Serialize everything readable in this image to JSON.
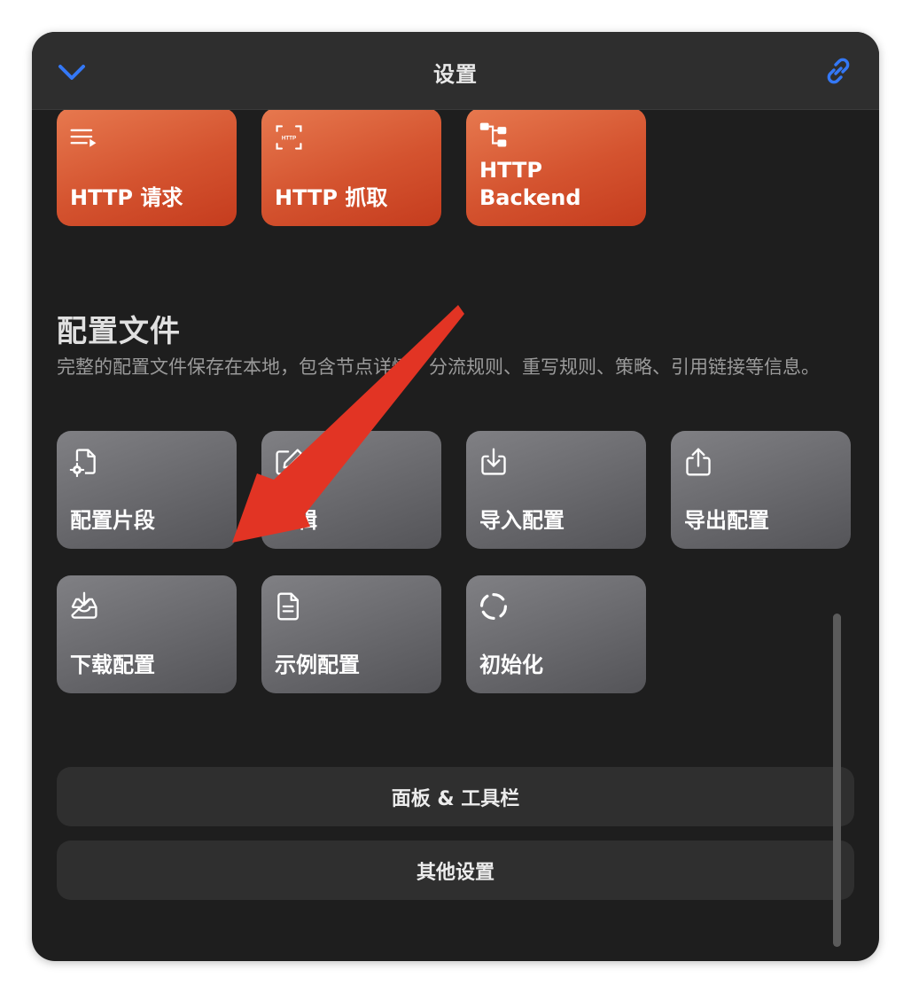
{
  "titlebar": {
    "title": "设置",
    "back_icon": "chevron-down-icon",
    "link_icon": "link-icon",
    "accent_color": "#3478f6"
  },
  "http_tiles": [
    {
      "label": "HTTP 请求",
      "icon": "list-play-icon"
    },
    {
      "label": "HTTP 抓取",
      "icon": "http-capture-icon"
    },
    {
      "label": "HTTP\nBackend",
      "icon": "hierarchy-icon"
    }
  ],
  "profile_section": {
    "title": "配置文件",
    "description": "完整的配置文件保存在本地，包含节点详情、分流规则、重写规则、策略、引用链接等信息。"
  },
  "profile_tiles": [
    {
      "label": "配置片段",
      "icon": "document-gear-icon"
    },
    {
      "label": "编辑",
      "icon": "edit-icon"
    },
    {
      "label": "导入配置",
      "icon": "import-icon"
    },
    {
      "label": "导出配置",
      "icon": "export-icon"
    },
    {
      "label": "下载配置",
      "icon": "download-tray-icon"
    },
    {
      "label": "示例配置",
      "icon": "document-lines-icon"
    },
    {
      "label": "初始化",
      "icon": "reset-circle-icon"
    }
  ],
  "buttons": {
    "panel_toolbar": "面板 & 工具栏",
    "other_settings": "其他设置"
  },
  "colors": {
    "tile_orange": "#d4532f",
    "tile_gray": "#6a6a6e",
    "annotation_arrow": "#e23424"
  }
}
